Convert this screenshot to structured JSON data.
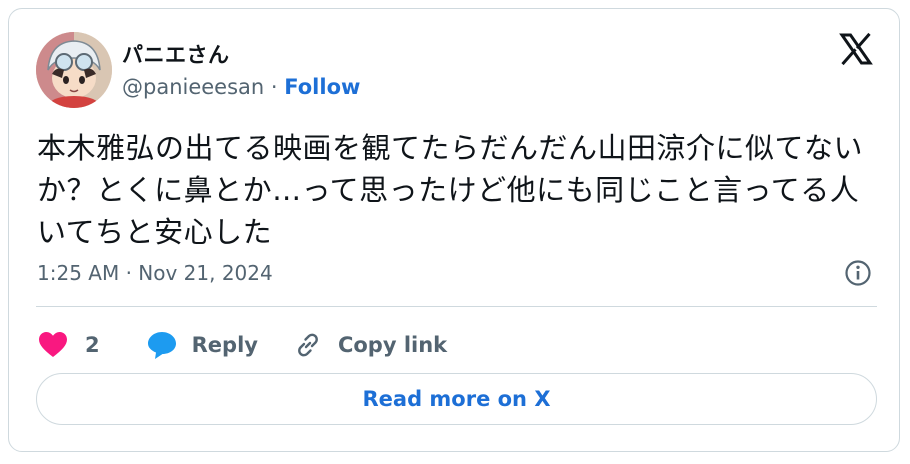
{
  "author": {
    "display_name": "パニエさん",
    "handle": "@panieeesan",
    "separator": " · ",
    "follow_label": "Follow"
  },
  "tweet": {
    "text": "本木雅弘の出てる映画を観てたらだんだん山田涼介に似てないか？とくに鼻とか…って思ったけど他にも同じこと言ってる人いてちと安心した",
    "timestamp": "1:25 AM · Nov 21, 2024"
  },
  "actions": {
    "like_count": "2",
    "reply_label": "Reply",
    "copy_link_label": "Copy link"
  },
  "cta": {
    "read_more_label": "Read more on X"
  },
  "colors": {
    "like": "#f91880",
    "reply": "#1d9bf0",
    "link": "#1d6fd6",
    "muted": "#536471",
    "border": "#cfd9de"
  },
  "icons": {
    "logo": "x-logo-icon",
    "info": "info-icon",
    "like": "heart-icon",
    "reply": "speech-bubble-icon",
    "copy": "chain-link-icon"
  }
}
